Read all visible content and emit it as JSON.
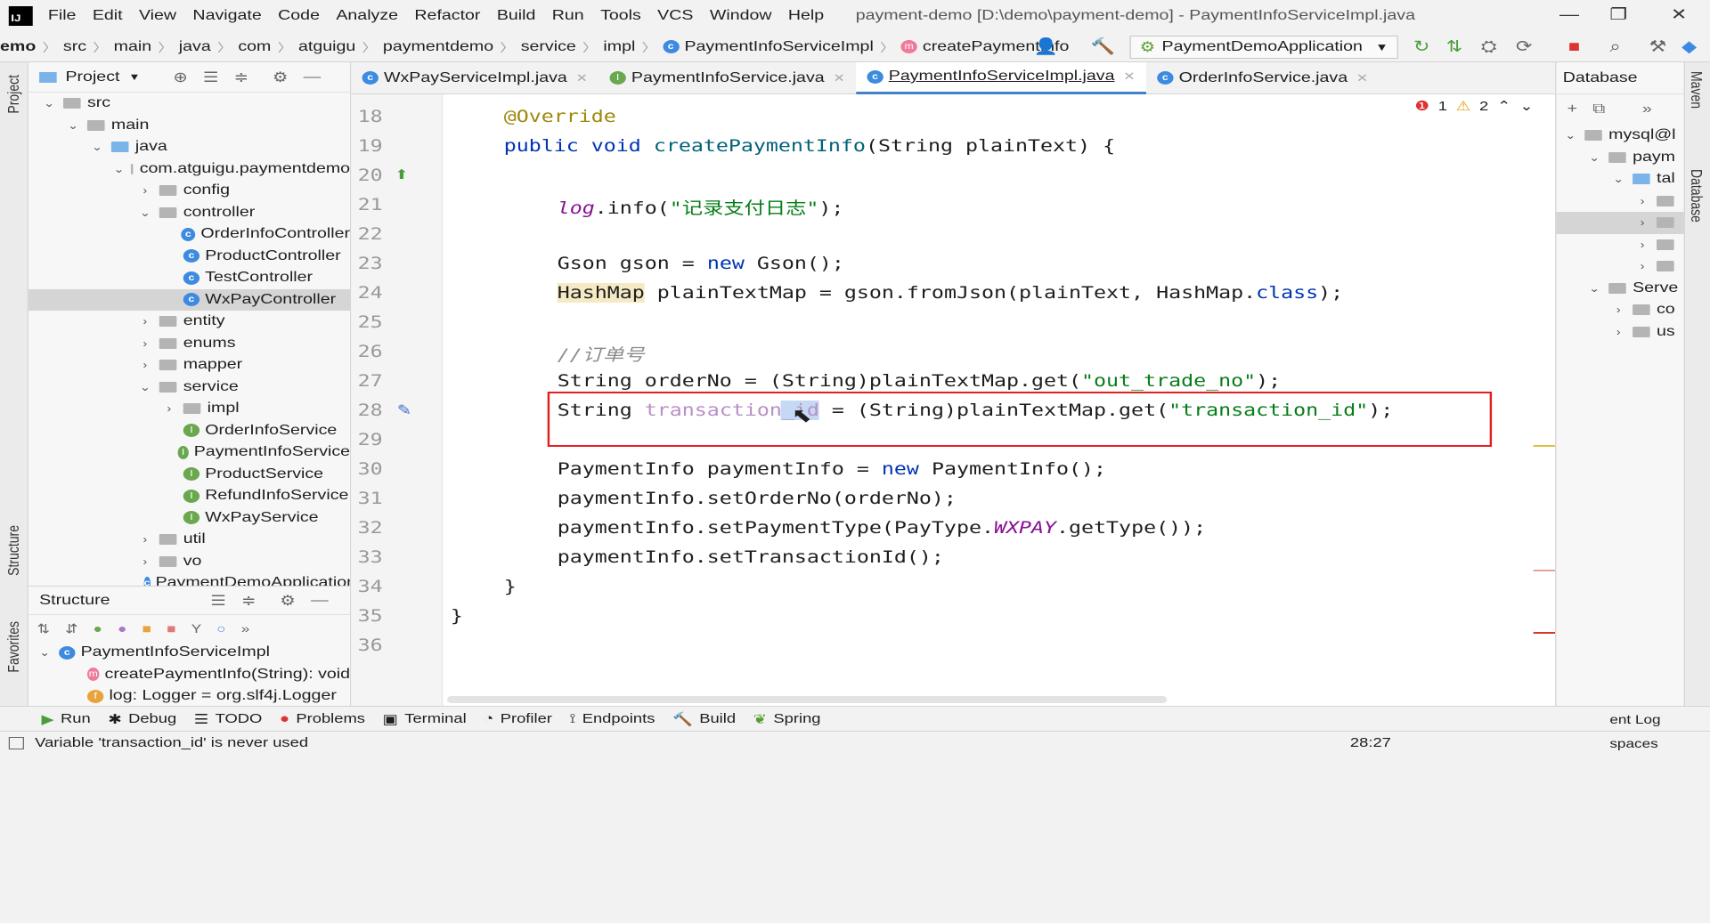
{
  "menu": [
    "File",
    "Edit",
    "View",
    "Navigate",
    "Code",
    "Analyze",
    "Refactor",
    "Build",
    "Run",
    "Tools",
    "VCS",
    "Window",
    "Help"
  ],
  "window_title": "payment-demo [D:\\demo\\payment-demo] - PaymentInfoServiceImpl.java",
  "breadcrumbs": [
    "emo",
    "src",
    "main",
    "java",
    "com",
    "atguigu",
    "paymentdemo",
    "service",
    "impl",
    "PaymentInfoServiceImpl",
    "createPaymentInfo"
  ],
  "run_config": "PaymentDemoApplication",
  "project_panel": {
    "title": "Project",
    "tree": [
      {
        "label": "src",
        "depth": 1,
        "kind": "folder",
        "arrow": "⌄"
      },
      {
        "label": "main",
        "depth": 2,
        "kind": "folder",
        "arrow": "⌄"
      },
      {
        "label": "java",
        "depth": 3,
        "kind": "folder-blue",
        "arrow": "⌄"
      },
      {
        "label": "com.atguigu.paymentdemo",
        "depth": 4,
        "kind": "folder",
        "arrow": "⌄"
      },
      {
        "label": "config",
        "depth": 5,
        "kind": "folder",
        "arrow": "›"
      },
      {
        "label": "controller",
        "depth": 5,
        "kind": "folder",
        "arrow": "⌄"
      },
      {
        "label": "OrderInfoController",
        "depth": 6,
        "kind": "class",
        "arrow": ""
      },
      {
        "label": "ProductController",
        "depth": 6,
        "kind": "class",
        "arrow": ""
      },
      {
        "label": "TestController",
        "depth": 6,
        "kind": "class",
        "arrow": ""
      },
      {
        "label": "WxPayController",
        "depth": 6,
        "kind": "class",
        "arrow": "",
        "selected": true
      },
      {
        "label": "entity",
        "depth": 5,
        "kind": "folder",
        "arrow": "›"
      },
      {
        "label": "enums",
        "depth": 5,
        "kind": "folder",
        "arrow": "›"
      },
      {
        "label": "mapper",
        "depth": 5,
        "kind": "folder",
        "arrow": "›"
      },
      {
        "label": "service",
        "depth": 5,
        "kind": "folder",
        "arrow": "⌄"
      },
      {
        "label": "impl",
        "depth": 6,
        "kind": "folder",
        "arrow": "›"
      },
      {
        "label": "OrderInfoService",
        "depth": 6,
        "kind": "interface",
        "arrow": ""
      },
      {
        "label": "PaymentInfoService",
        "depth": 6,
        "kind": "interface",
        "arrow": ""
      },
      {
        "label": "ProductService",
        "depth": 6,
        "kind": "interface",
        "arrow": ""
      },
      {
        "label": "RefundInfoService",
        "depth": 6,
        "kind": "interface",
        "arrow": ""
      },
      {
        "label": "WxPayService",
        "depth": 6,
        "kind": "interface",
        "arrow": ""
      },
      {
        "label": "util",
        "depth": 5,
        "kind": "folder",
        "arrow": "›"
      },
      {
        "label": "vo",
        "depth": 5,
        "kind": "folder",
        "arrow": "›"
      },
      {
        "label": "PaymentDemoApplication",
        "depth": 5,
        "kind": "class",
        "arrow": ""
      }
    ]
  },
  "structure_panel": {
    "title": "Structure",
    "items": [
      {
        "label": "PaymentInfoServiceImpl",
        "icon": "c"
      },
      {
        "label": "createPaymentInfo(String): void",
        "icon": "m"
      },
      {
        "label": "log: Logger = org.slf4j.Logger",
        "icon": "f"
      }
    ]
  },
  "editor_tabs": [
    {
      "label": "WxPayServiceImpl.java",
      "icon": "c",
      "active": false
    },
    {
      "label": "PaymentInfoService.java",
      "icon": "i",
      "active": false
    },
    {
      "label": "PaymentInfoServiceImpl.java",
      "icon": "c",
      "active": true
    },
    {
      "label": "OrderInfoService.java",
      "icon": "c",
      "active": false
    }
  ],
  "inspections": {
    "errors": "1",
    "warnings": "2"
  },
  "line_numbers": [
    "18",
    "19",
    "20",
    "21",
    "22",
    "23",
    "24",
    "25",
    "26",
    "27",
    "28",
    "29",
    "30",
    "31",
    "32",
    "33",
    "34",
    "35",
    "36"
  ],
  "code": {
    "l18": "@Override",
    "l19a": "public void ",
    "l19b": "createPaymentInfo",
    "l19c": "(String plainText) {",
    "l21a": "log",
    "l21b": ".info(",
    "l21c": "\"记录支付日志\"",
    "l21d": ");",
    "l23a": "Gson gson = ",
    "l23b": "new ",
    "l23c": "Gson();",
    "l24a": "HashMap",
    "l24b": " plainTextMap = gson.fromJson(plainText, HashMap.",
    "l24c": "class",
    "l24d": ");",
    "l26": "//订单号",
    "l27a": "String orderNo = (String)plainTextMap.get(",
    "l27b": "\"out_trade_no\"",
    "l27c": ");",
    "l28a": "String ",
    "l28b": "transaction_id",
    "l28c": " = (String)plainTextMap.get(",
    "l28d": "\"transaction_id\"",
    "l28e": ");",
    "l30a": "PaymentInfo paymentInfo = ",
    "l30b": "new ",
    "l30c": "PaymentInfo();",
    "l31": "paymentInfo.setOrderNo(orderNo);",
    "l32a": "paymentInfo.setPaymentType(PayType.",
    "l32b": "WXPAY",
    "l32c": ".getType());",
    "l33": "paymentInfo.setTransactionId();",
    "l34": "}",
    "l35": "}"
  },
  "database_panel": {
    "title": "Database",
    "items": [
      {
        "label": "mysql@l",
        "depth": 0,
        "arrow": "⌄"
      },
      {
        "label": "paym",
        "depth": 1,
        "arrow": "⌄"
      },
      {
        "label": "tal",
        "depth": 2,
        "arrow": "⌄"
      },
      {
        "label": "",
        "depth": 3,
        "arrow": "›"
      },
      {
        "label": "",
        "depth": 3,
        "arrow": "›"
      },
      {
        "label": "",
        "depth": 3,
        "arrow": "›"
      },
      {
        "label": "",
        "depth": 3,
        "arrow": "›"
      },
      {
        "label": "Serve",
        "depth": 1,
        "arrow": "⌄"
      },
      {
        "label": "co",
        "depth": 2,
        "arrow": "›"
      },
      {
        "label": "us",
        "depth": 2,
        "arrow": "›"
      }
    ]
  },
  "side_labels": {
    "project": "Project",
    "structure": "Structure",
    "favorites": "Favorites",
    "maven": "Maven",
    "database": "Database"
  },
  "bottom_tools": [
    "Run",
    "Debug",
    "TODO",
    "Problems",
    "Terminal",
    "Profiler",
    "Endpoints",
    "Build",
    "Spring"
  ],
  "status": {
    "message": "Variable 'transaction_id' is never used",
    "position": "28:27",
    "event_log": "ent Log",
    "spaces": "spaces"
  }
}
